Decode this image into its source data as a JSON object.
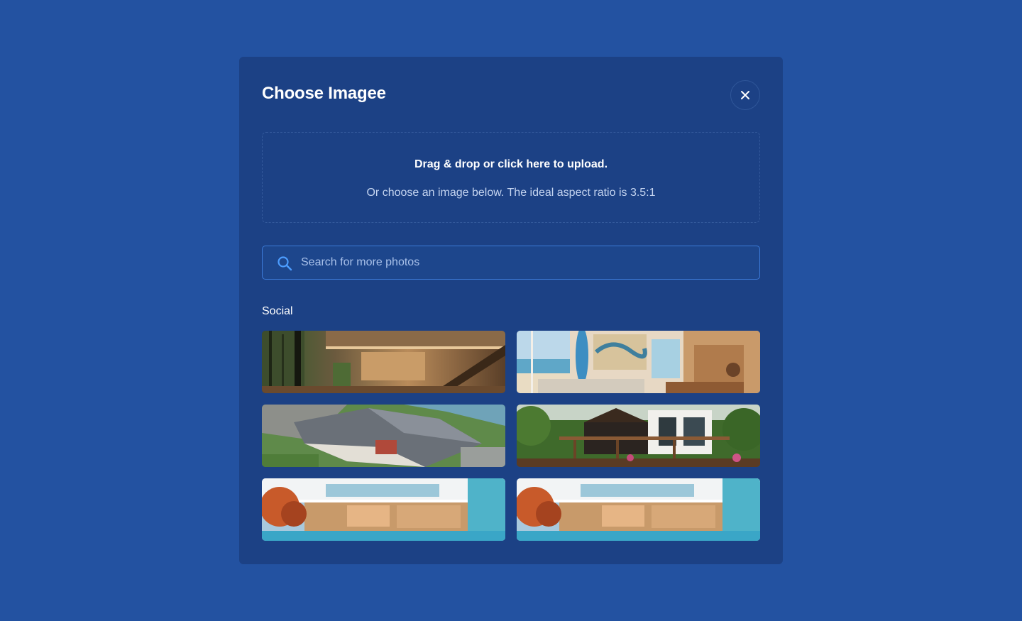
{
  "modal": {
    "title": "Choose Imagee",
    "close_icon": "close-icon"
  },
  "upload": {
    "title": "Drag & drop or click here to upload.",
    "subtitle": "Or choose an image below. The ideal aspect ratio is 3.5:1"
  },
  "search": {
    "icon": "search-icon",
    "placeholder": "Search for more photos",
    "value": ""
  },
  "section": {
    "label": "Social"
  },
  "colors": {
    "page_bg": "#2352a1",
    "modal_bg": "#1c4185",
    "accent": "#3c7ad8"
  }
}
